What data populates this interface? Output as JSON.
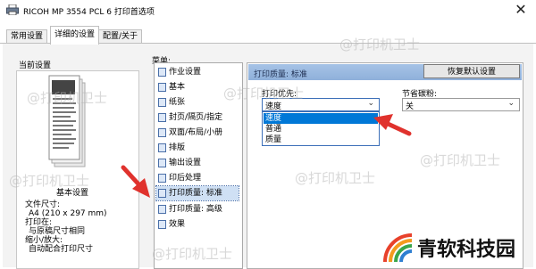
{
  "window": {
    "title": "RICOH MP 3554 PCL 6 打印首选项",
    "close_glyph": "✕"
  },
  "tabs": [
    {
      "label": "常用设置",
      "active": false
    },
    {
      "label": "详细的设置",
      "active": true
    },
    {
      "label": "配置/关于",
      "active": false
    }
  ],
  "left": {
    "header": "当前设置",
    "caption": "基本设置",
    "info": [
      "文件尺寸:",
      "A4 (210 x 297 mm)",
      "打印在:",
      "与原稿尺寸相同",
      "缩小/放大:",
      "自动配合打印尺寸"
    ]
  },
  "menu": {
    "label": "菜单:",
    "items": [
      {
        "label": "作业设置",
        "icon": "job-settings-icon"
      },
      {
        "label": "基本",
        "icon": "basic-icon"
      },
      {
        "label": "纸张",
        "icon": "paper-icon"
      },
      {
        "label": "封页/隔页/指定",
        "icon": "cover-icon"
      },
      {
        "label": "双面/布局/小册",
        "icon": "duplex-icon"
      },
      {
        "label": "排版",
        "icon": "layout-icon"
      },
      {
        "label": "输出设置",
        "icon": "output-icon"
      },
      {
        "label": "印后处理",
        "icon": "finishing-icon"
      },
      {
        "label": "打印质量: 标准",
        "icon": "quality-standard-icon",
        "selected": true
      },
      {
        "label": "打印质量: 高级",
        "icon": "quality-advanced-icon"
      },
      {
        "label": "效果",
        "icon": "effects-icon"
      }
    ]
  },
  "panel": {
    "title": "打印质量: 标准",
    "reset_button": "恢复默认设置",
    "priority": {
      "label": "打印优先:",
      "value": "速度",
      "options": [
        {
          "label": "速度",
          "selected": true
        },
        {
          "label": "普通",
          "selected": false
        },
        {
          "label": "质量",
          "selected": false
        }
      ]
    },
    "toner": {
      "label": "节省碳粉:",
      "value": "关"
    }
  },
  "watermark": {
    "text": "@打印机卫士"
  },
  "brand": {
    "name": "青软科技园"
  },
  "colors": {
    "accent": "#0078d7",
    "arrow": "#e0322d",
    "panel_header": "#a6c3e6"
  }
}
